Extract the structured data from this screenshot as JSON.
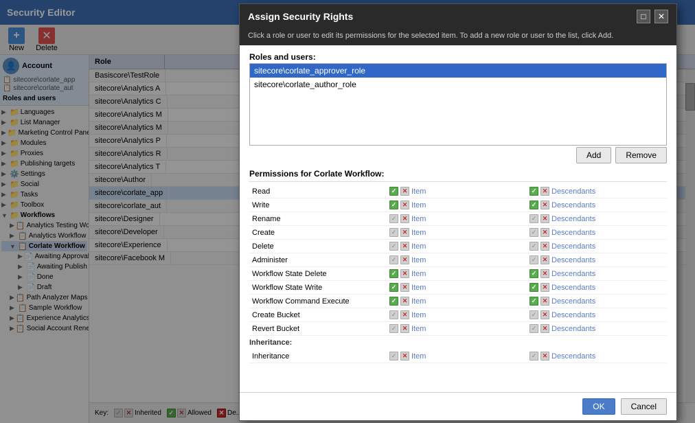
{
  "app": {
    "title": "Security Editor"
  },
  "toolbar": {
    "new_label": "New",
    "delete_label": "Delete"
  },
  "tree": {
    "account_label": "Account",
    "roles_users_label": "Roles and users",
    "items": [
      {
        "label": "sitecore\\corlate_approver_role",
        "short": "sitecore\\corlate_app"
      },
      {
        "label": "sitecore\\corlate_author_role",
        "short": "sitecore\\corlate_aut"
      }
    ],
    "nav_items": [
      {
        "label": "Languages"
      },
      {
        "label": "List Manager"
      },
      {
        "label": "Marketing Control Panel"
      },
      {
        "label": "Modules"
      },
      {
        "label": "Proxies"
      },
      {
        "label": "Publishing targets"
      },
      {
        "label": "Settings"
      },
      {
        "label": "Social"
      },
      {
        "label": "Tasks"
      },
      {
        "label": "Toolbox"
      },
      {
        "label": "Workflows"
      },
      {
        "label": "Analytics Testing Workflow"
      },
      {
        "label": "Analytics Workflow"
      },
      {
        "label": "Corlate Workflow"
      },
      {
        "label": "Awaiting Approval"
      },
      {
        "label": "Awaiting Publish"
      },
      {
        "label": "Done"
      },
      {
        "label": "Draft"
      },
      {
        "label": "Path Analyzer Maps"
      },
      {
        "label": "Sample Workflow"
      },
      {
        "label": "Experience Analytics Segment"
      },
      {
        "label": "Social Account Renewal"
      }
    ]
  },
  "table": {
    "col_role": "Role",
    "rows": [
      {
        "label": "Basiscore\\TestRole"
      },
      {
        "label": "sitecore\\Analytics A"
      },
      {
        "label": "sitecore\\Analytics C"
      },
      {
        "label": "sitecore\\Analytics M"
      },
      {
        "label": "sitecore\\Analytics M"
      },
      {
        "label": "sitecore\\Analytics P"
      },
      {
        "label": "sitecore\\Analytics R"
      },
      {
        "label": "sitecore\\Analytics T"
      },
      {
        "label": "sitecore\\Author"
      },
      {
        "label": "sitecore\\corlate_app",
        "selected": true
      },
      {
        "label": "sitecore\\corlate_aut"
      },
      {
        "label": "sitecore\\Designer"
      },
      {
        "label": "sitecore\\Developer"
      },
      {
        "label": "sitecore\\Experience"
      }
    ]
  },
  "dialog": {
    "title": "Assign Security Rights",
    "subtitle": "Click a role or user to edit its permissions for the selected item. To add a new role or user to the list, click Add.",
    "roles_label": "Roles and users:",
    "roles": [
      {
        "label": "sitecore\\corlate_approver_role",
        "selected": true
      },
      {
        "label": "sitecore\\corlate_author_role",
        "selected": false
      }
    ],
    "add_button": "Add",
    "remove_button": "Remove",
    "permissions_title": "Permissions for Corlate Workflow:",
    "permissions": [
      {
        "name": "Read",
        "item_state": "green",
        "item_label": "Item",
        "desc_state": "green",
        "desc_label": "Descendants"
      },
      {
        "name": "Write",
        "item_state": "green",
        "item_label": "Item",
        "desc_state": "green",
        "desc_label": "Descendants"
      },
      {
        "name": "Rename",
        "item_state": "gray",
        "item_label": "Item",
        "desc_state": "gray",
        "desc_label": "Descendants"
      },
      {
        "name": "Create",
        "item_state": "gray",
        "item_label": "Item",
        "desc_state": "gray",
        "desc_label": "Descendants"
      },
      {
        "name": "Delete",
        "item_state": "gray",
        "item_label": "Item",
        "desc_state": "gray",
        "desc_label": "Descendants"
      },
      {
        "name": "Administer",
        "item_state": "gray",
        "item_label": "Item",
        "desc_state": "gray",
        "desc_label": "Descendants"
      },
      {
        "name": "Workflow State Delete",
        "item_state": "green",
        "item_label": "Item",
        "desc_state": "green",
        "desc_label": "Descendants"
      },
      {
        "name": "Workflow State Write",
        "item_state": "green",
        "item_label": "Item",
        "desc_state": "green",
        "desc_label": "Descendants"
      },
      {
        "name": "Workflow Command Execute",
        "item_state": "green",
        "item_label": "Item",
        "desc_state": "green",
        "desc_label": "Descendants"
      },
      {
        "name": "Create Bucket",
        "item_state": "gray",
        "item_label": "Item",
        "desc_state": "gray",
        "desc_label": "Descendants"
      },
      {
        "name": "Revert Bucket",
        "item_state": "gray",
        "item_label": "Item",
        "desc_state": "gray",
        "desc_label": "Descendants"
      }
    ],
    "inheritance_label": "Inheritance:",
    "inheritance_row": {
      "name": "Inheritance",
      "item_state": "gray",
      "item_label": "Item",
      "desc_state": "gray",
      "desc_label": "Descendants"
    },
    "ok_button": "OK",
    "cancel_button": "Cancel"
  },
  "legend": {
    "key_label": "Key:",
    "inherited_label": "Inherited",
    "allowed_label": "Allowed",
    "denied_label": "De..."
  }
}
